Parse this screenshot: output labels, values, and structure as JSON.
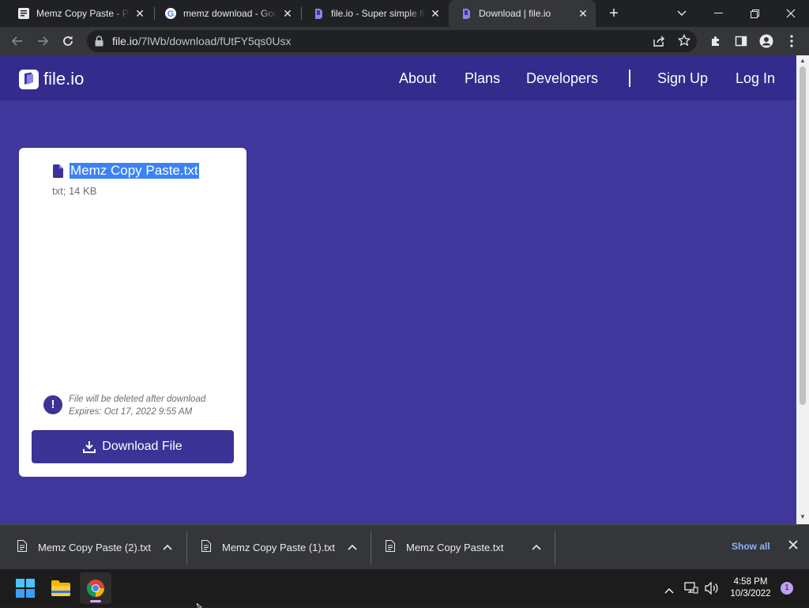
{
  "browser": {
    "tabs": [
      {
        "title": "Memz Copy Paste - Pastebin",
        "favicon": "pastebin-icon",
        "active": false
      },
      {
        "title": "memz download - Google Search",
        "favicon": "google-icon",
        "active": false
      },
      {
        "title": "file.io - Super simple file sharing",
        "favicon": "fileio-icon",
        "active": false
      },
      {
        "title": "Download | file.io",
        "favicon": "fileio-icon",
        "active": true
      }
    ],
    "url_host": "file.io",
    "url_path": "/7lWb/download/fUtFY5qs0Usx"
  },
  "site": {
    "logo_text": "file.io",
    "nav": {
      "about": "About",
      "plans": "Plans",
      "developers": "Developers",
      "signup": "Sign Up",
      "login": "Log In"
    },
    "card": {
      "file_name": "Memz Copy Paste.txt",
      "file_meta": "txt; 14 KB",
      "warning_line1": "File will be deleted after download",
      "warning_line2": "Expires: Oct 17, 2022 9:55 AM",
      "download_label": "Download File"
    },
    "colors": {
      "page_bg": "#3f379c",
      "nav_bg": "#332c8c",
      "accent": "#3b3396",
      "selection": "#3b82f6"
    }
  },
  "downloads": {
    "items": [
      {
        "name": "Memz Copy Paste (2).txt"
      },
      {
        "name": "Memz Copy Paste (1).txt"
      },
      {
        "name": "Memz Copy Paste.txt"
      }
    ],
    "show_all": "Show all"
  },
  "taskbar": {
    "time": "4:58 PM",
    "date": "10/3/2022",
    "notification_count": "1"
  }
}
